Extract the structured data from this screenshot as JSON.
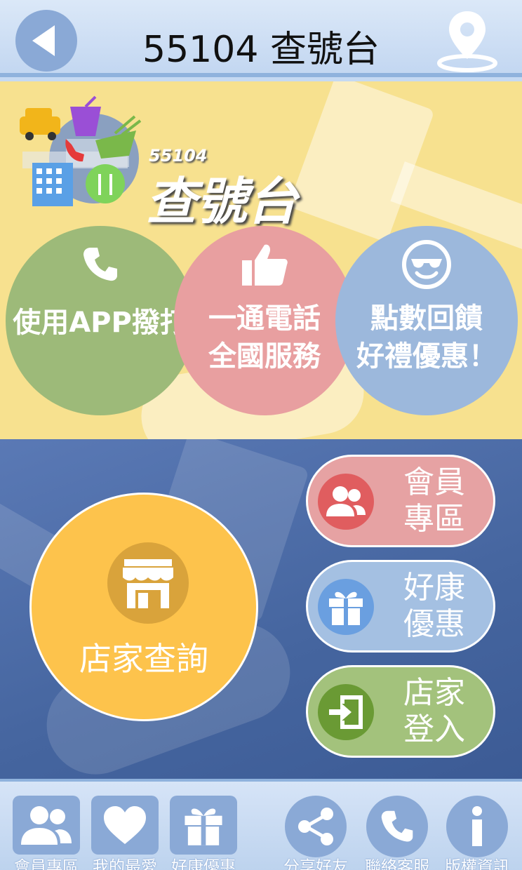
{
  "header": {
    "title": "55104 查號台",
    "back_icon": "back-arrow-icon",
    "location_icon": "location-pin-icon"
  },
  "banner": {
    "logo_number": "55104",
    "logo_text": "查號台",
    "circles": [
      {
        "label_line1": "使用APP撥打",
        "label_line2": "",
        "icon": "phone-icon",
        "color": "#9dba79"
      },
      {
        "label_line1": "一通電話",
        "label_line2": "全國服務",
        "icon": "thumbs-up-icon",
        "color": "#e89fa0"
      },
      {
        "label_line1": "點數回饋",
        "label_line2": "好禮優惠！",
        "icon": "smiley-sunglasses-icon",
        "color": "#9cb8dc"
      }
    ]
  },
  "main": {
    "store_search_label": "店家查詢",
    "member_label_line1": "會員",
    "member_label_line2": "專區",
    "deals_label_line1": "好康",
    "deals_label_line2": "優惠",
    "store_login_label_line1": "店家",
    "store_login_label_line2": "登入"
  },
  "bottom_nav": [
    {
      "label": "會員專區",
      "icon": "members-icon"
    },
    {
      "label": "我的最愛",
      "icon": "heart-icon"
    },
    {
      "label": "好康優惠",
      "icon": "gift-icon"
    },
    {
      "label": "分享好友",
      "icon": "share-icon"
    },
    {
      "label": "聯絡客服",
      "icon": "phone-icon"
    },
    {
      "label": "版權資訊",
      "icon": "info-icon"
    }
  ],
  "colors": {
    "banner_bg": "#f7e18f",
    "main_bg": "#45659f",
    "store_button": "#fdc34c",
    "member_pill": "#e6a2a3",
    "deals_pill": "#a4c0e2",
    "login_pill": "#a3c27c"
  }
}
